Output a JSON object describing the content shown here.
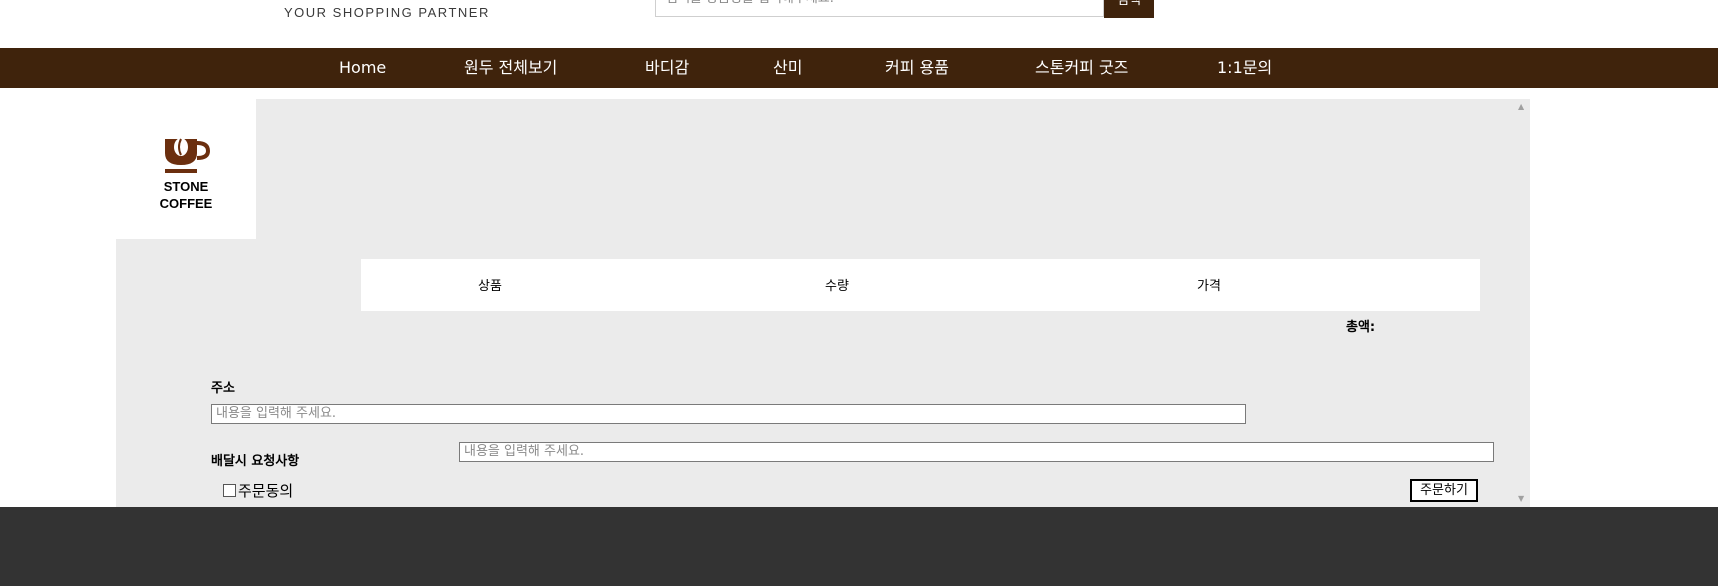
{
  "header": {
    "tagline": "YOUR SHOPPING PARTNER",
    "search_placeholder": "검색을 상품명을 입력해주세요.",
    "search_button": "검색"
  },
  "nav": [
    "Home",
    "원두 전체보기",
    "바디감",
    "산미",
    "커피 용품",
    "스톤커피 굿즈",
    "1:1문의"
  ],
  "logo": {
    "line1": "STONE",
    "line2": "COFFEE"
  },
  "cart": {
    "columns": [
      "상품",
      "수량",
      "가격"
    ],
    "total_label": "총액:"
  },
  "form": {
    "address_label": "주소",
    "address_placeholder": "내용을 입력해 주세요.",
    "request_label": "배달시 요청사항",
    "request_placeholder": "내용을 입력해 주세요.",
    "agree_label": "주문동의",
    "order_button": "주문하기"
  },
  "colors": {
    "brand": "#3f230c",
    "panel": "#ebebeb",
    "footer": "#333333"
  }
}
